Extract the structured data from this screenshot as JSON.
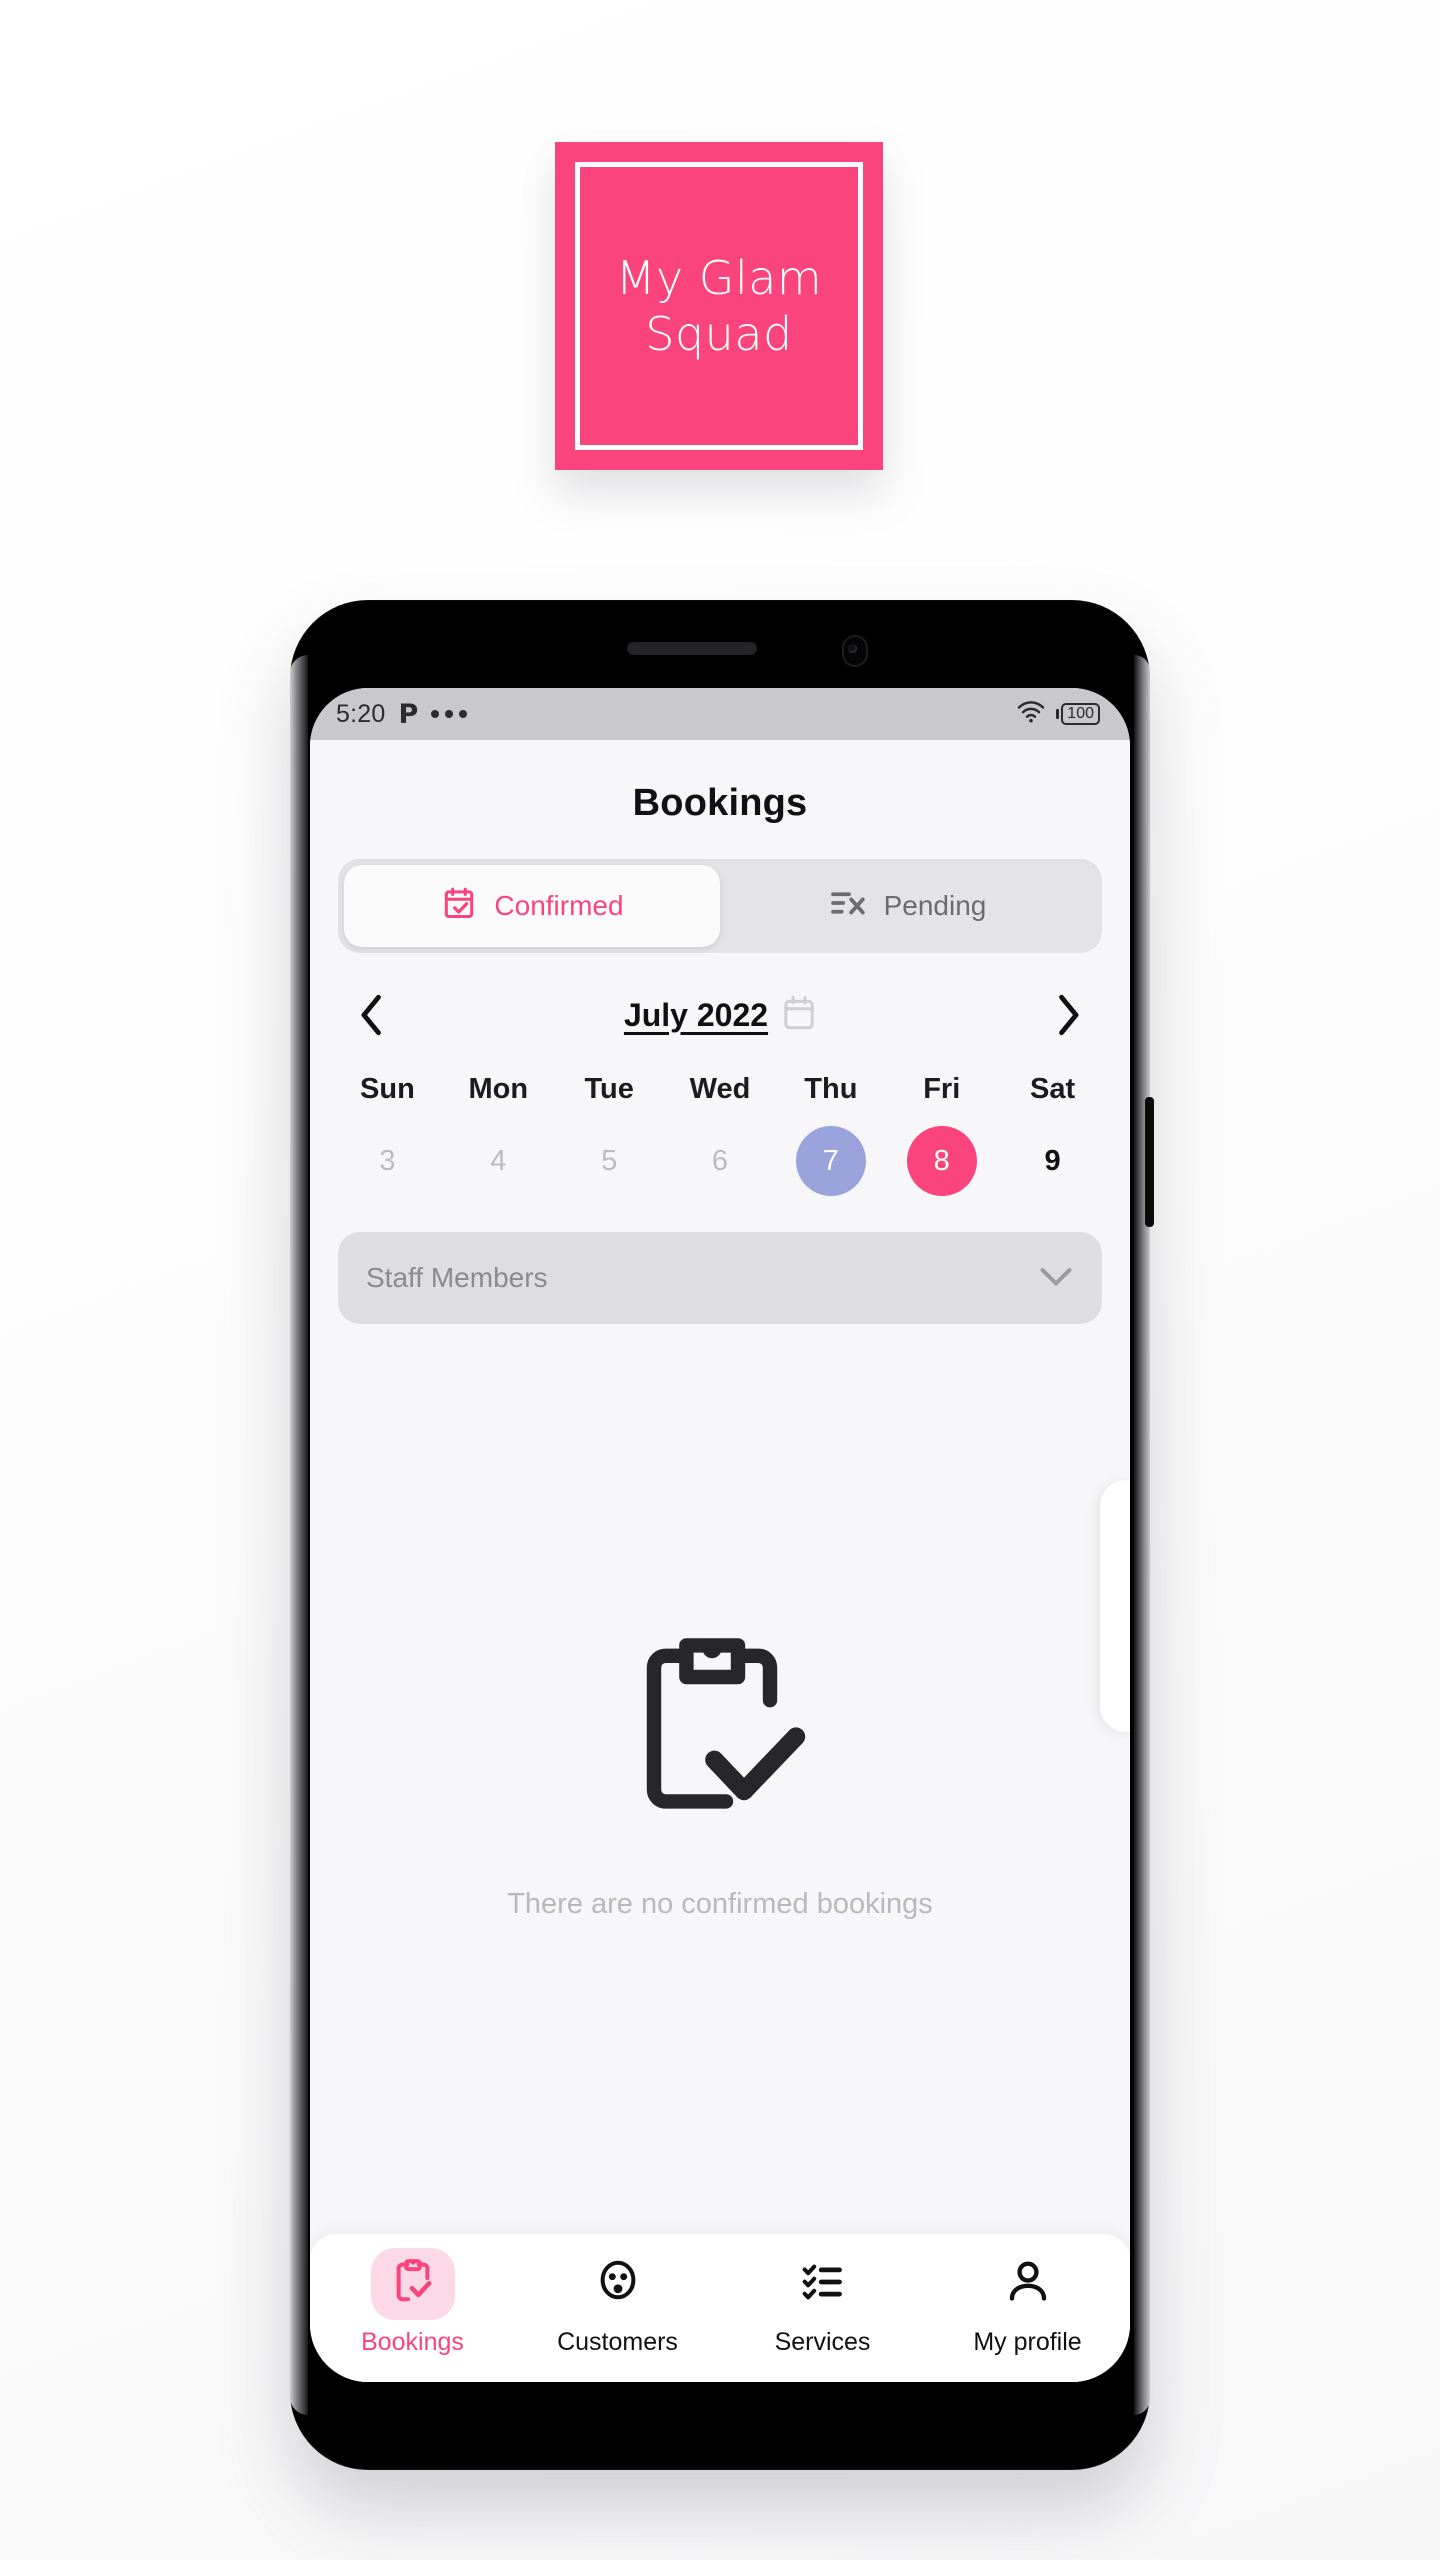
{
  "brand": {
    "accent_pink": "#f9447e",
    "accent_pink_soft": "#fcd9e6",
    "today_periwinkle": "#9aa3dc",
    "logo_line1": "My Glam",
    "logo_line2": "Squad"
  },
  "status_bar": {
    "time": "5:20",
    "app_badge": "P",
    "overflow_icon": "more-dots-icon",
    "wifi_icon": "wifi-icon",
    "battery_level": "100"
  },
  "header": {
    "title": "Bookings"
  },
  "tabs": [
    {
      "label": "Confirmed",
      "icon": "calendar-check-icon",
      "active": true
    },
    {
      "label": "Pending",
      "icon": "list-x-icon",
      "active": false
    }
  ],
  "calendar": {
    "prev_icon": "chevron-left-icon",
    "next_icon": "chevron-right-icon",
    "month_label": "July 2022",
    "calendar_icon": "calendar-icon",
    "weekdays": [
      "Sun",
      "Mon",
      "Tue",
      "Wed",
      "Thu",
      "Fri",
      "Sat"
    ],
    "days": [
      {
        "num": "3",
        "state": "past"
      },
      {
        "num": "4",
        "state": "past"
      },
      {
        "num": "5",
        "state": "past"
      },
      {
        "num": "6",
        "state": "past"
      },
      {
        "num": "7",
        "state": "today"
      },
      {
        "num": "8",
        "state": "selected"
      },
      {
        "num": "9",
        "state": "normal"
      }
    ]
  },
  "staff_filter": {
    "label": "Staff Members",
    "chevron_icon": "chevron-down-icon"
  },
  "empty_state": {
    "icon": "clipboard-check-icon",
    "message": "There are no confirmed bookings"
  },
  "bottom_nav": [
    {
      "label": "Bookings",
      "icon": "clipboard-check-icon",
      "active": true
    },
    {
      "label": "Customers",
      "icon": "people-face-icon",
      "active": false
    },
    {
      "label": "Services",
      "icon": "checklist-icon",
      "active": false
    },
    {
      "label": "My profile",
      "icon": "person-icon",
      "active": false
    }
  ]
}
